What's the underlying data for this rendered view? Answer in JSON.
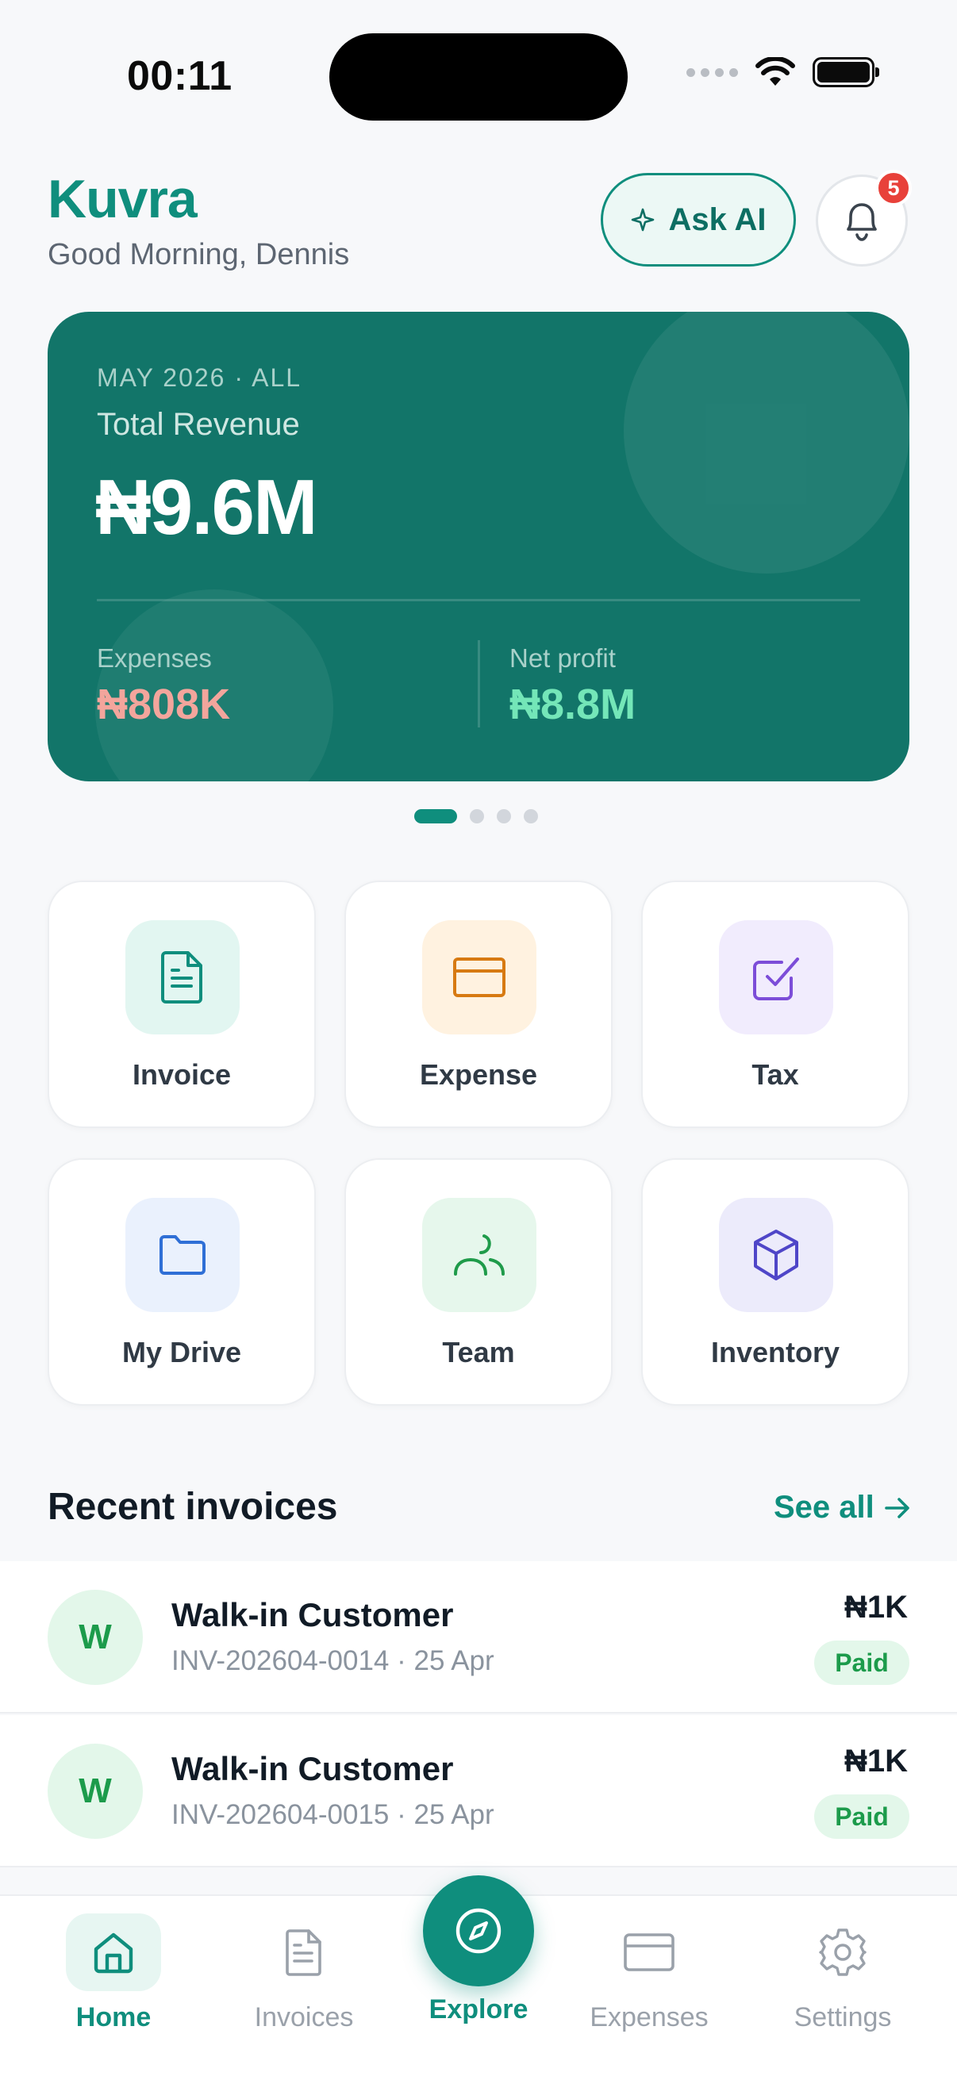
{
  "status_bar": {
    "time": "00:11"
  },
  "header": {
    "brand": "Kuvra",
    "greeting": "Good Morning, Dennis",
    "ask_ai_label": "Ask AI",
    "notification_count": "5"
  },
  "revenue_card": {
    "period": "MAY 2026 · ALL",
    "label": "Total Revenue",
    "value": "₦9.6M",
    "expenses_label": "Expenses",
    "expenses_value": "₦808K",
    "net_profit_label": "Net profit",
    "net_profit_value": "₦8.8M",
    "carousel_pages": 4,
    "carousel_active": 1
  },
  "quick_actions": [
    {
      "label": "Invoice",
      "icon": "document-icon",
      "color": "#0f8e7d",
      "bg": "#e2f6f1"
    },
    {
      "label": "Expense",
      "icon": "card-icon",
      "color": "#d77a12",
      "bg": "#fff2e0"
    },
    {
      "label": "Tax",
      "icon": "checkbox-icon",
      "color": "#7c4dd8",
      "bg": "#f1ecfd"
    },
    {
      "label": "My Drive",
      "icon": "folder-icon",
      "color": "#2f6fd6",
      "bg": "#eaf1fd"
    },
    {
      "label": "Team",
      "icon": "team-icon",
      "color": "#1f9b4a",
      "bg": "#e6f7ec"
    },
    {
      "label": "Inventory",
      "icon": "box-icon",
      "color": "#4f46c8",
      "bg": "#ecebfb"
    }
  ],
  "recent_invoices": {
    "title": "Recent invoices",
    "see_all": "See all",
    "items": [
      {
        "initial": "W",
        "name": "Walk-in Customer",
        "meta": "INV-202604-0014 · 25 Apr",
        "amount": "₦1K",
        "status": "Paid"
      },
      {
        "initial": "W",
        "name": "Walk-in Customer",
        "meta": "INV-202604-0015 · 25 Apr",
        "amount": "₦1K",
        "status": "Paid"
      }
    ]
  },
  "bottom_nav": {
    "items": [
      {
        "label": "Home",
        "icon": "home-icon",
        "active": true
      },
      {
        "label": "Invoices",
        "icon": "document-icon",
        "active": false
      },
      {
        "label": "Explore",
        "icon": "compass-icon",
        "active": false
      },
      {
        "label": "Expenses",
        "icon": "card-icon",
        "active": false
      },
      {
        "label": "Settings",
        "icon": "gear-icon",
        "active": false
      }
    ]
  },
  "colors": {
    "brand": "#0f8e7d",
    "card_bg": "#127569",
    "expenses": "#f3a59c",
    "net_profit": "#74e6b8",
    "paid": "#1c9b4b",
    "badge": "#e8413a"
  }
}
